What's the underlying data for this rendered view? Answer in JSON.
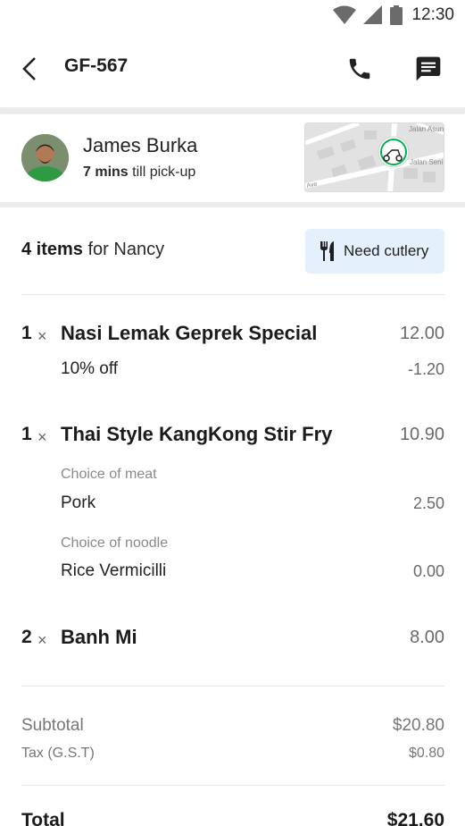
{
  "status_bar": {
    "time": "12:30",
    "icons": [
      "wifi-icon",
      "signal-icon",
      "battery-icon"
    ]
  },
  "app_bar": {
    "order_id": "GF-567",
    "icons": [
      "back-arrow-icon",
      "phone-icon",
      "message-icon"
    ]
  },
  "driver": {
    "name": "James Burka",
    "pickup_mins": "7 mins",
    "pickup_suffix": " till pick-up",
    "map_labels": [
      "Jalan Asun",
      "Jalan Seni",
      "Ave"
    ]
  },
  "order": {
    "count": "4 items",
    "for_text": " for Nancy",
    "cutlery_label": "Need cutlery",
    "items": [
      {
        "qty": "1",
        "times": "×",
        "name": "Nasi Lemak Geprek Special",
        "price": "12.00",
        "discount_label": "10% off",
        "discount_value": "-1.20"
      },
      {
        "qty": "1",
        "times": "×",
        "name": "Thai Style KangKong Stir Fry",
        "price": "10.90",
        "options": [
          {
            "label": "Choice of meat",
            "value": "Pork",
            "price": "2.50"
          },
          {
            "label": "Choice of noodle",
            "value": "Rice Vermicilli",
            "price": "0.00"
          }
        ]
      },
      {
        "qty": "2",
        "times": "×",
        "name": "Banh Mi",
        "price": "8.00"
      }
    ]
  },
  "summary": {
    "subtotal_label": "Subtotal",
    "subtotal_value": "$20.80",
    "tax_label": "Tax (G.S.T)",
    "tax_value": "$0.80",
    "total_label": "Total",
    "total_value": "$21.60"
  },
  "colors": {
    "accent_green": "#00b14f",
    "cutlery_bg": "#e4f1fd"
  }
}
